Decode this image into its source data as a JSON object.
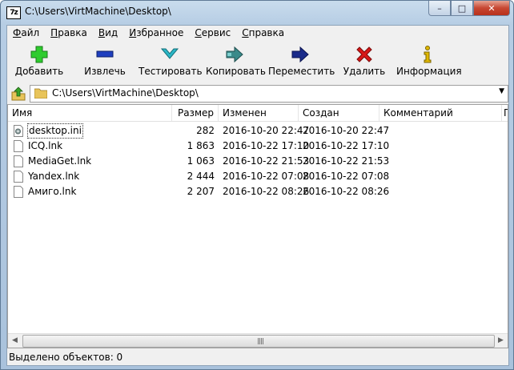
{
  "window": {
    "title": "C:\\Users\\VirtMachine\\Desktop\\",
    "app_icon_text": "7z"
  },
  "caption": {
    "minimize": "–",
    "maximize": "□",
    "close": "✕"
  },
  "menu": [
    {
      "underline": "Ф",
      "rest": "айл"
    },
    {
      "underline": "П",
      "rest": "равка"
    },
    {
      "underline": "В",
      "rest": "ид"
    },
    {
      "underline": "И",
      "rest": "збранное"
    },
    {
      "underline": "С",
      "rest": "ервис"
    },
    {
      "underline": "С",
      "rest": "правка"
    }
  ],
  "toolbar": {
    "add": "Добавить",
    "extract": "Извлечь",
    "test": "Тестировать",
    "copy": "Копировать",
    "move": "Переместить",
    "delete": "Удалить",
    "info": "Информация"
  },
  "address": {
    "path": "C:\\Users\\VirtMachine\\Desktop\\"
  },
  "columns": {
    "name": "Имя",
    "size": "Размер",
    "modified": "Изменен",
    "created": "Создан",
    "comment": "Комментарий",
    "extra": "Г"
  },
  "files": [
    {
      "name": "desktop.ini",
      "size": "282",
      "modified": "2016-10-20 22:47",
      "created": "2016-10-20 22:47"
    },
    {
      "name": "ICQ.lnk",
      "size": "1 863",
      "modified": "2016-10-22 17:10",
      "created": "2016-10-22 17:10"
    },
    {
      "name": "MediaGet.lnk",
      "size": "1 063",
      "modified": "2016-10-22 21:53",
      "created": "2016-10-22 21:53"
    },
    {
      "name": "Yandex.lnk",
      "size": "2 444",
      "modified": "2016-10-22 07:08",
      "created": "2016-10-22 07:08"
    },
    {
      "name": "Амиго.lnk",
      "size": "2 207",
      "modified": "2016-10-22 08:26",
      "created": "2016-10-22 08:26"
    }
  ],
  "status": {
    "text": "Выделено объектов: 0"
  },
  "colors": {
    "add": "#2ecc2e",
    "extract": "#1f3fbf",
    "test": "#2ab7c7",
    "copy": "#3a8a8a",
    "move": "#1a2b8a",
    "delete": "#d81818",
    "info": "#e0b800"
  }
}
